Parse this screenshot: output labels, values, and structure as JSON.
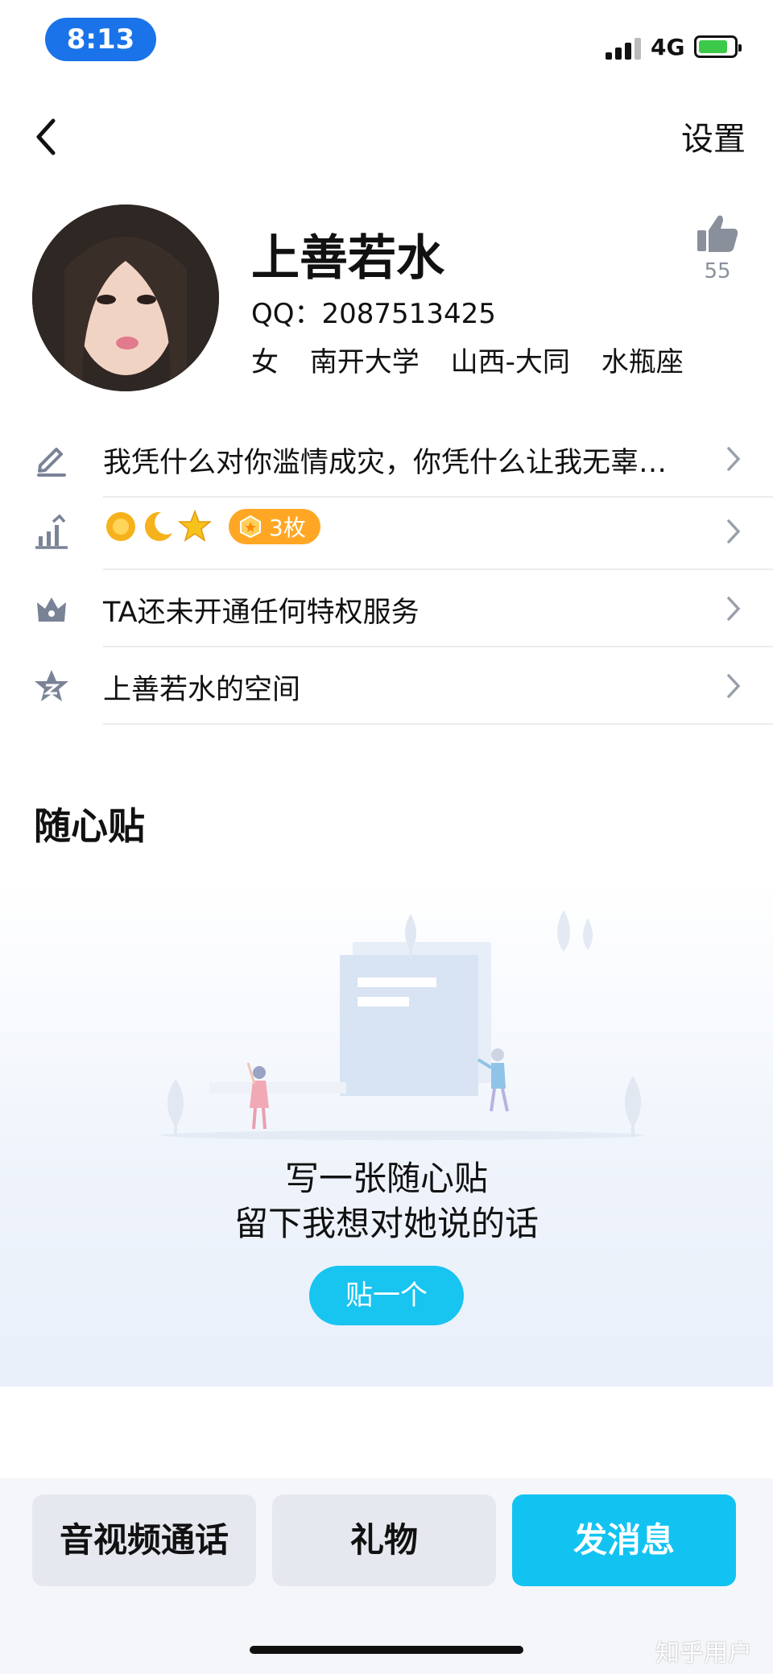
{
  "status_bar": {
    "time": "8:13",
    "network": "4G"
  },
  "nav": {
    "settings_label": "设置"
  },
  "profile": {
    "nickname": "上善若水",
    "qq_line": "QQ：2087513425",
    "gender": "女",
    "school": "南开大学",
    "location": "山西-大同",
    "zodiac": "水瓶座",
    "like_count": "55"
  },
  "rows": {
    "signature": "我凭什么对你滥情成灾，你凭什么让我无辜…",
    "level_badge_count": "3枚",
    "privilege": "TA还未开通任何特权服务",
    "space": "上善若水的空间"
  },
  "section": {
    "title": "随心贴",
    "empty_line1": "写一张随心贴",
    "empty_line2": "留下我想对她说的话",
    "post_button": "贴一个"
  },
  "bottom_bar": {
    "call_label": "音视频通话",
    "gift_label": "礼物",
    "message_label": "发消息"
  },
  "watermark": "知乎用户",
  "colors": {
    "accent": "#12c3f2",
    "time_pill": "#1a73e8",
    "badge_orange": "#ffa724"
  }
}
